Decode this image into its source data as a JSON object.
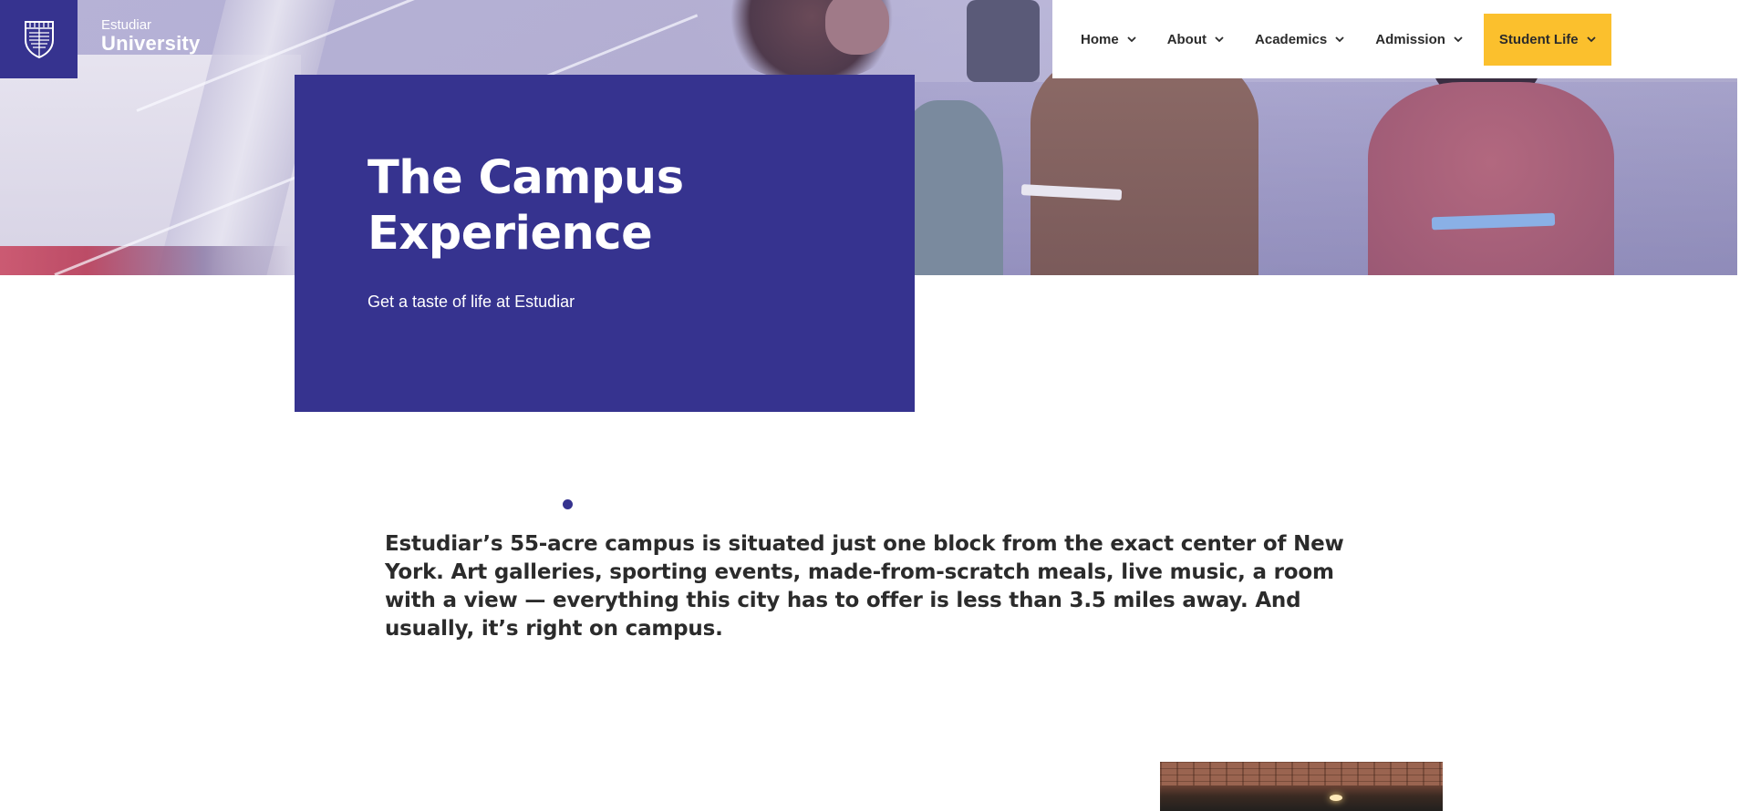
{
  "brand": {
    "line1": "Estudiar",
    "line2": "University",
    "logo_icon": "shield-crest-icon"
  },
  "nav": {
    "items": [
      {
        "label": "Home",
        "icon": "chevron-down-icon"
      },
      {
        "label": "About",
        "icon": "chevron-down-icon"
      },
      {
        "label": "Academics",
        "icon": "chevron-down-icon"
      },
      {
        "label": "Admission",
        "icon": "chevron-down-icon"
      },
      {
        "label": "Student Life",
        "icon": "chevron-down-icon",
        "active": true
      }
    ]
  },
  "hero": {
    "title": "The Campus Experience",
    "subtitle": "Get a taste of life at Estudiar"
  },
  "intro": {
    "text": "Estudiar’s 55-acre campus is situated just one block from the exact center of New York. Art galleries, sporting events, made-from-scratch meals, live music, a room with a view — everything this city has to offer is less than 3.5 miles away. And usually, it’s right on campus."
  },
  "colors": {
    "primary": "#36338f",
    "accent": "#fbc02d",
    "text": "#2b2b2b",
    "white": "#ffffff"
  }
}
